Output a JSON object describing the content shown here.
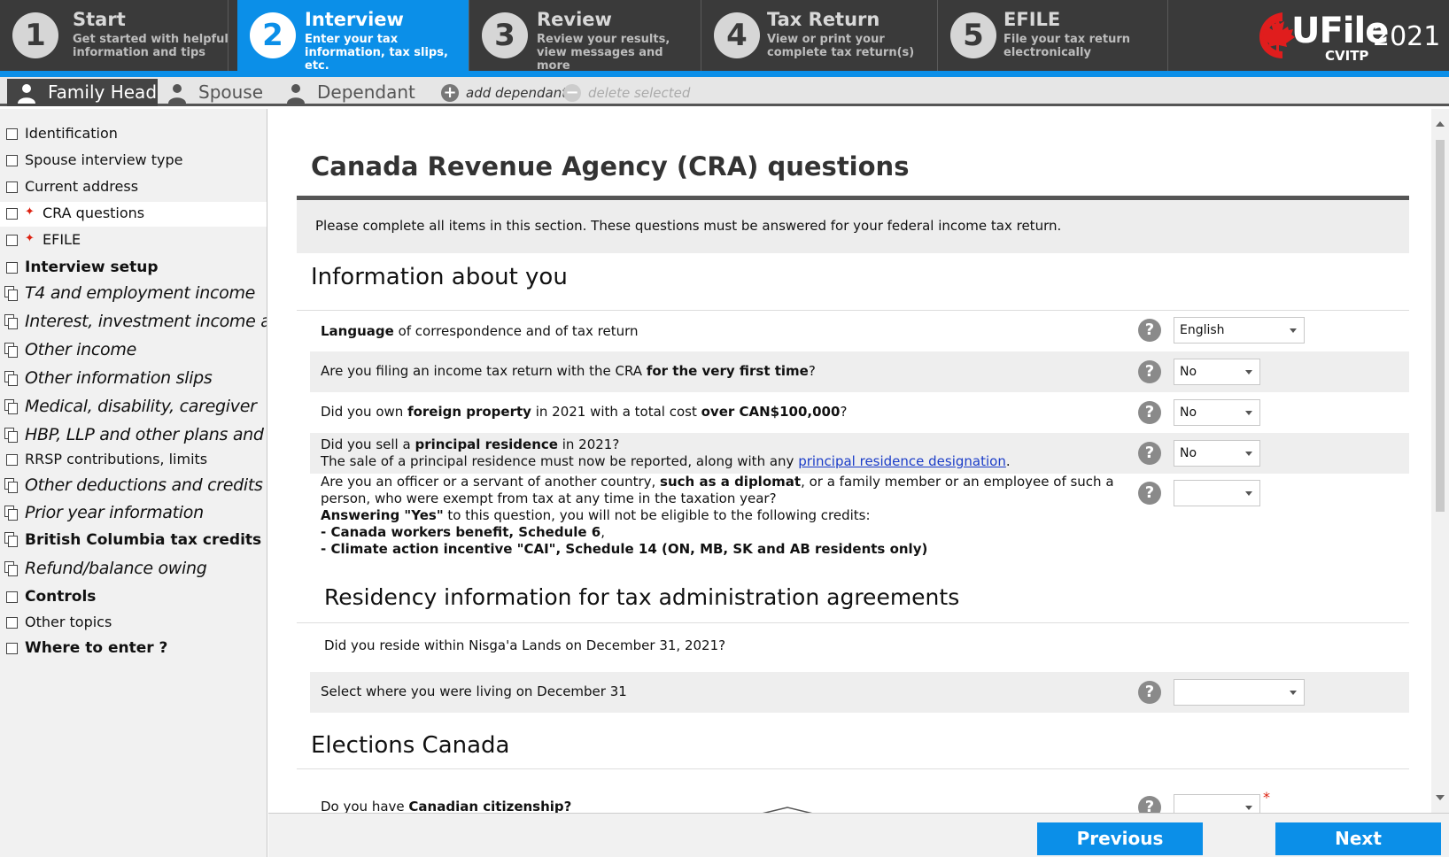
{
  "steps": [
    {
      "num": "1",
      "title": "Start",
      "desc": "Get started with helpful information and tips"
    },
    {
      "num": "2",
      "title": "Interview",
      "desc": "Enter your tax information, tax slips, etc."
    },
    {
      "num": "3",
      "title": "Review",
      "desc": "Review your results, view messages and more"
    },
    {
      "num": "4",
      "title": "Tax Return",
      "desc": "View or print your complete tax return(s)"
    },
    {
      "num": "5",
      "title": "EFILE",
      "desc": "File your tax return electronically"
    }
  ],
  "logo": {
    "brand": "UFile",
    "year": "2021",
    "sub": "CVITP"
  },
  "persons": {
    "tabs": [
      "Family Head",
      "Spouse",
      "Dependant"
    ],
    "add_label": "add dependant",
    "delete_label": "delete selected"
  },
  "sidebar": {
    "items": [
      "Identification",
      "Spouse interview type",
      "Current address",
      "CRA questions",
      "EFILE",
      "Interview setup",
      "T4 and employment income",
      "Interest, investment income and",
      "Other income",
      "Other information slips",
      "Medical, disability, caregiver",
      "HBP, LLP and other plans and fi",
      "RRSP contributions, limits",
      "Other deductions and credits",
      "Prior year information",
      "British Columbia tax credits",
      "Refund/balance owing",
      "Controls",
      "Other topics",
      "Where to enter ?"
    ]
  },
  "page": {
    "title": "Canada Revenue Agency (CRA) questions",
    "intro": "Please complete all items in this section. These questions must be answered for your federal income tax return."
  },
  "sections": {
    "about_you": "Information about you",
    "residency": "Residency information for tax administration agreements",
    "elections": "Elections Canada"
  },
  "questions": {
    "q1": {
      "p1": "Language",
      "p2": " of correspondence and of tax return",
      "value": "English"
    },
    "q2": {
      "p1": "Are you filing an income tax return with the CRA ",
      "p2": "for the very first time",
      "p3": "?",
      "value": "No"
    },
    "q3": {
      "p1": "Did you own ",
      "p2": "foreign property",
      "p3": " in 2021 with a total cost ",
      "p4": "over CAN$100,000",
      "p5": "?",
      "value": "No"
    },
    "q4": {
      "p1": "Did you sell a ",
      "p2": "principal residence",
      "p3": " in 2021?",
      "p4": "The sale of a principal residence must now be reported, along with any ",
      "link": "principal residence designation",
      "p5": ".",
      "value": "No"
    },
    "q5": {
      "p1": "Are you an officer or a servant of another country, ",
      "p2": "such as a diplomat",
      "p3": ", or a family member or an employee of such a",
      "p4": "person, who were exempt from tax at any time in the taxation year?",
      "p5": "Answering \"Yes\"",
      "p6": " to this question, you will not be eligible to the following credits:",
      "p7": "- Canada workers benefit, Schedule 6",
      "p8": "- Climate action incentive \"CAI\", Schedule 14 (ON, MB, SK and AB residents only)",
      "value": ""
    },
    "q6": {
      "text": "Did you reside within Nisga'a Lands on December 31, 2021?"
    },
    "q7": {
      "text": "Select where you were living on December 31",
      "value": ""
    },
    "q8": {
      "p1": "Do you have ",
      "p2": "Canadian citizenship?",
      "value": ""
    }
  },
  "help_symbol": "?",
  "required_symbol": "*",
  "footer": {
    "previous": "Previous",
    "next": "Next"
  }
}
